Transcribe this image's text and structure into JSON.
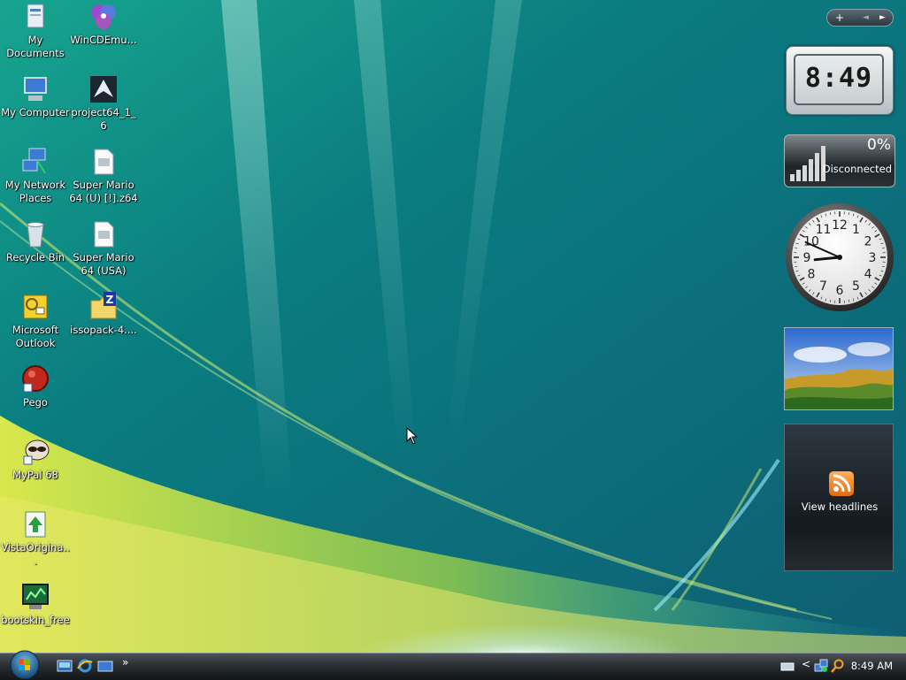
{
  "desktop_icons": [
    {
      "label": "My Documents",
      "icon": "my-documents-icon"
    },
    {
      "label": "WinCDEmu...",
      "icon": "wincdemu-icon"
    },
    {
      "label": "My Computer",
      "icon": "my-computer-icon"
    },
    {
      "label": "project64_1_6",
      "icon": "project64-icon"
    },
    {
      "label": "My Network Places",
      "icon": "network-places-icon"
    },
    {
      "label": "Super Mario 64 (U) [!].z64",
      "icon": "rom-file-icon"
    },
    {
      "label": "Recycle Bin",
      "icon": "recycle-bin-icon"
    },
    {
      "label": "Super Mario 64 (USA)",
      "icon": "rom-file-icon"
    },
    {
      "label": "Microsoft Outlook",
      "icon": "outlook-icon"
    },
    {
      "label": "issopack-4....",
      "icon": "zip-folder-icon"
    },
    {
      "label": "Pego",
      "icon": "pego-icon"
    },
    {
      "label": "MyPal 68",
      "icon": "mypal-icon"
    },
    {
      "label": "VistaOrigina...",
      "icon": "installer-icon"
    },
    {
      "label": "bootskin_free",
      "icon": "bootskin-icon"
    }
  ],
  "sidebar": {
    "controls": {
      "add": "+",
      "prev": "◄",
      "next": "►"
    },
    "digital_clock": {
      "time": "8:49"
    },
    "network_meter": {
      "percent": "0%",
      "status": "Disconnected"
    },
    "analog_clock": {
      "hour": 8,
      "minute": 49,
      "numerals": [
        "12",
        "1",
        "2",
        "3",
        "4",
        "5",
        "6",
        "7",
        "8",
        "9",
        "10",
        "11"
      ]
    },
    "feed_headlines": {
      "label": "View headlines"
    }
  },
  "taskbar": {
    "clock": "8:49 AM",
    "tray_expand": "<",
    "quick_launch_more": "»"
  },
  "colors": {
    "accent_orange": "#e06a0c",
    "taskbar": "#2a2f33"
  }
}
